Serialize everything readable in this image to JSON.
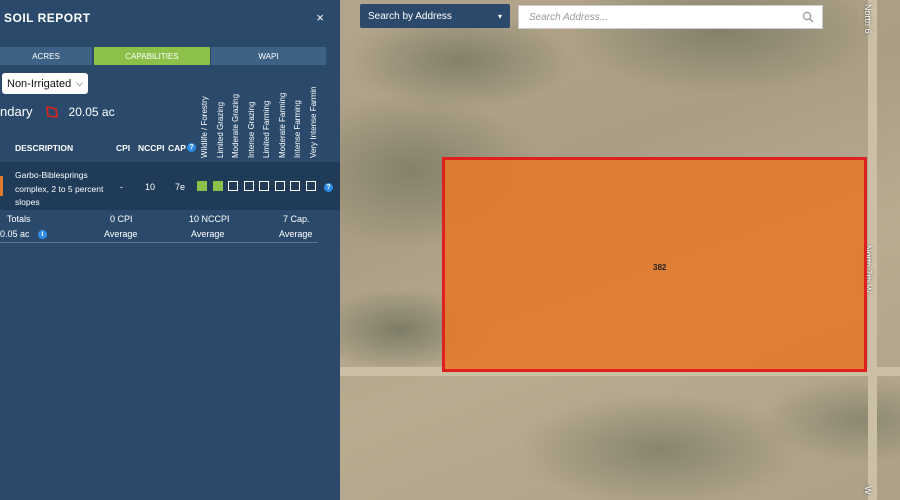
{
  "panel": {
    "title": "SOIL REPORT",
    "close": "×",
    "tabs": [
      {
        "label": "ACRES",
        "active": false
      },
      {
        "label": "CAPABILITIES",
        "active": true
      },
      {
        "label": "WAPI",
        "active": false
      }
    ],
    "irrigation": "Non-Irrigated",
    "boundary": {
      "label": "ndary",
      "acres": "20.05 ac"
    },
    "capability_classes": [
      "Wildlife / Forestry",
      "Limited Grazing",
      "Moderate Grazing",
      "Intense Grazing",
      "Limited Farming",
      "Moderate Farming",
      "Intense Farming",
      "Very Intense Farmin"
    ],
    "table_headers": {
      "description": "DESCRIPTION",
      "cpi": "CPI",
      "nccpi": "NCCPI",
      "cap": "CAP"
    },
    "rows": [
      {
        "description": "Garbo-Biblesprings complex, 2 to 5 percent slopes",
        "cpi": "-",
        "nccpi": "10",
        "cap": "7e",
        "filled_classes": 2
      }
    ],
    "totals": {
      "label": "Totals",
      "acres": "0.05 ac",
      "cpi": "0 CPI",
      "cpi_sub": "Average",
      "nccpi": "10 NCCPI",
      "nccpi_sub": "Average",
      "cap": "7 Cap.",
      "cap_sub": "Average"
    },
    "colors": {
      "panel": "#2b4a6b",
      "active_tab": "#8cc04b",
      "soil_swatch": "#e07a2e"
    }
  },
  "map": {
    "search_mode": "Search by Address",
    "search_placeholder": "Search Address...",
    "road_label_top": "North 6",
    "road_label_mid": "North 7th W",
    "road_label_bottom": "W",
    "parcel_label": "382",
    "colors": {
      "parcel_fill": "#e6782a",
      "parcel_border": "#e0201c"
    }
  }
}
